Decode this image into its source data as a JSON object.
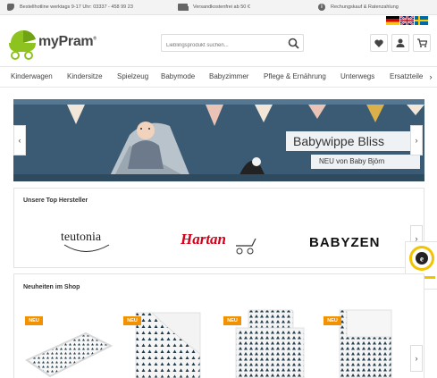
{
  "topbar": {
    "hotline": "Bestellhotline werktags 9-17 Uhr: 03337 - 458 99 23",
    "shipping": "Versandkostenfrei ab 50 €",
    "payment": "Rechungskauf & Ratenzahlung"
  },
  "header": {
    "logo_text": "myPram",
    "logo_registered": "®",
    "search_placeholder": "Lieblingsprodukt suchen...",
    "languages": [
      "de",
      "en",
      "sv"
    ]
  },
  "nav": {
    "items": [
      "Kinderwagen",
      "Kindersitze",
      "Spielzeug",
      "Babymode",
      "Babyzimmer",
      "Pflege & Ernährung",
      "Unterwegs",
      "Ersatzteile"
    ]
  },
  "slider": {
    "title": "Babywippe Bliss",
    "subtitle": "NEU von Baby Björn"
  },
  "manufacturers": {
    "title": "Unsere Top Hersteller",
    "brands": [
      "teutonia",
      "Hartan",
      "BABYZEN"
    ]
  },
  "new_products": {
    "title": "Neuheiten im Shop",
    "badge": "NEU",
    "items": [
      "changing-mat",
      "quilt",
      "bedding-set",
      "sleeping-bag"
    ]
  },
  "colors": {
    "accent_green": "#8dc21f",
    "badge_orange": "#f39200",
    "slider_blue": "#3b5a73"
  }
}
